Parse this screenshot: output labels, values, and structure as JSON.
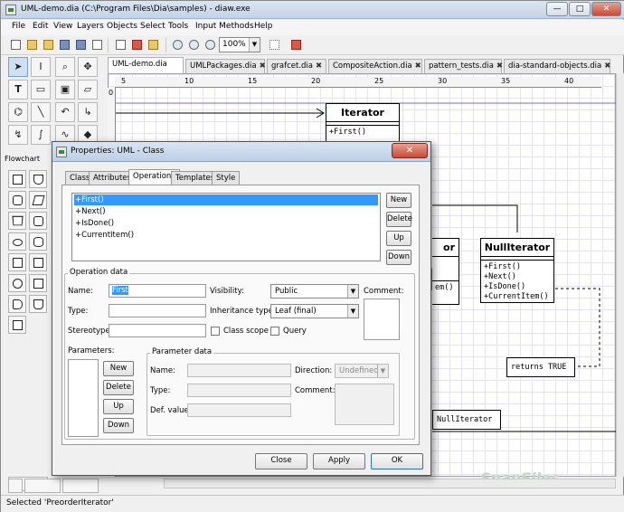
{
  "window": {
    "title": "UML-demo.dia (C:\\Program Files\\Dia\\samples) - diaw.exe",
    "minimize": "—",
    "maximize": "□",
    "close": "✕"
  },
  "menu": [
    "File",
    "Edit",
    "View",
    "Layers",
    "Objects",
    "Select",
    "Tools",
    "Input Methods",
    "Help"
  ],
  "toolbar": {
    "zoom": "100%"
  },
  "toolbox": {
    "sheet": "Flowchart"
  },
  "diagram_tabs": [
    "UML-demo.dia",
    "UMLPackages.dia",
    "grafcet.dia",
    "CompositeAction.dia",
    "pattern_tests.dia",
    "dia-standard-objects.dia"
  ],
  "ruler": {
    "ticks": [
      "5",
      "10",
      "15",
      "20",
      "25",
      "30",
      "35",
      "40"
    ],
    "left_zero": "0"
  },
  "canvas": {
    "iterator": {
      "name": "Iterator",
      "ops": [
        "+First()"
      ]
    },
    "null_iterator": {
      "name": "NullIterator",
      "ops": [
        "+First()",
        "+Next()",
        "+IsDone()",
        "+CurrentItem()"
      ]
    },
    "partial_class": {
      "name": "or",
      "ops": [
        "em()"
      ]
    },
    "note_returns": "returns TRUE",
    "note_null": "NullIterator"
  },
  "status": "Selected 'PreorderIterator'",
  "watermark": "SnapFiles",
  "dialog": {
    "title": "Properties: UML - Class",
    "close": "✕",
    "tabs": [
      "Class",
      "Attributes",
      "Operations",
      "Templates",
      "Style"
    ],
    "active_tab": "Operations",
    "operations": [
      "+First()",
      "+Next()",
      "+IsDone()",
      "+CurrentItem()"
    ],
    "list_buttons": {
      "new": "New",
      "delete": "Delete",
      "up": "Up",
      "down": "Down"
    },
    "operation_data": {
      "legend": "Operation data",
      "name_label": "Name:",
      "name_value": "First",
      "type_label": "Type:",
      "stereotype_label": "Stereotype:",
      "visibility_label": "Visibility:",
      "visibility_value": "Public",
      "inheritance_label": "Inheritance type:",
      "inheritance_value": "Leaf (final)",
      "class_scope": "Class scope",
      "query": "Query",
      "comment_label": "Comment:"
    },
    "parameters": {
      "label": "Parameters:",
      "buttons": {
        "new": "New",
        "delete": "Delete",
        "up": "Up",
        "down": "Down"
      },
      "legend": "Parameter data",
      "name_label": "Name:",
      "type_label": "Type:",
      "def_label": "Def. value:",
      "direction_label": "Direction:",
      "direction_value": "Undefined",
      "comment_label": "Comment:"
    },
    "footer": {
      "close": "Close",
      "apply": "Apply",
      "ok": "OK"
    }
  }
}
